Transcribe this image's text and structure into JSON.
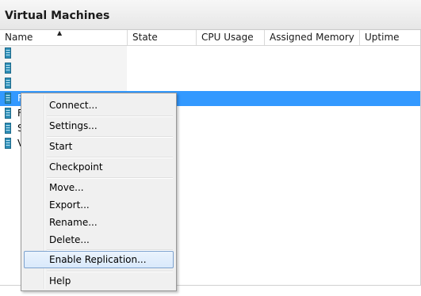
{
  "panel": {
    "title": "Virtual Machines"
  },
  "columns": [
    {
      "label": "Name"
    },
    {
      "label": "State"
    },
    {
      "label": "CPU Usage"
    },
    {
      "label": "Assigned Memory"
    },
    {
      "label": "Uptime"
    }
  ],
  "sort": {
    "column": "Name",
    "direction": "ascending",
    "icon": "sort-ascending-icon"
  },
  "vms": [
    {
      "name": "",
      "icon": "vm-icon"
    },
    {
      "name": "",
      "icon": "vm-icon"
    },
    {
      "name": "",
      "icon": "vm-icon"
    },
    {
      "name": "F",
      "icon": "vm-icon",
      "selected": true
    },
    {
      "name": "F",
      "icon": "vm-icon"
    },
    {
      "name": "S",
      "icon": "vm-icon"
    },
    {
      "name": "V",
      "icon": "vm-icon"
    }
  ],
  "context_menu": {
    "items": [
      {
        "label": "Connect..."
      },
      {
        "label": "Settings..."
      },
      {
        "label": "Start"
      },
      {
        "label": "Checkpoint"
      },
      {
        "label": "Move..."
      },
      {
        "label": "Export..."
      },
      {
        "label": "Rename..."
      },
      {
        "label": "Delete..."
      },
      {
        "label": "Enable Replication...",
        "highlighted": true
      },
      {
        "label": "Help"
      }
    ]
  },
  "colors": {
    "selection": "#3399ff",
    "menu_background": "#f0f0f0",
    "menu_highlight_border": "#7da2ce"
  }
}
